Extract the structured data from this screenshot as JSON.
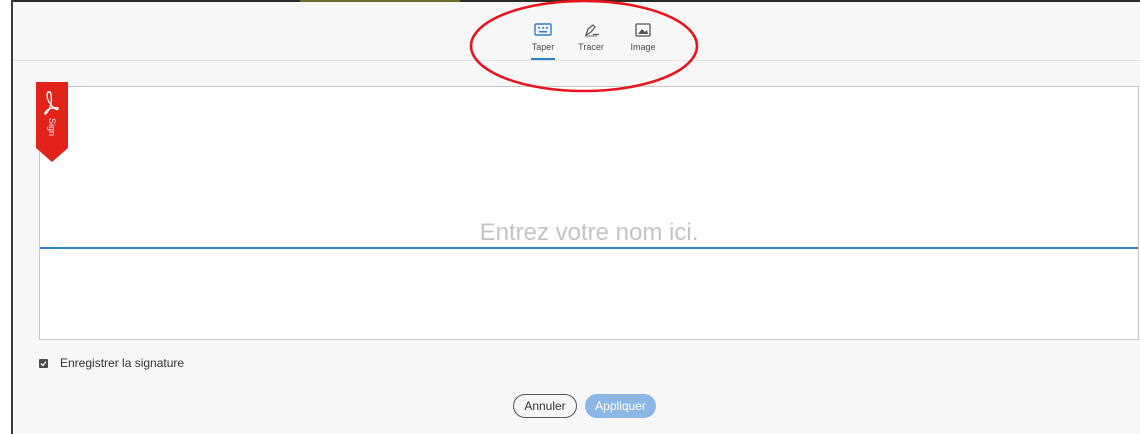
{
  "tabs": [
    {
      "label": "Taper",
      "icon": "keyboard-icon",
      "active": true
    },
    {
      "label": "Tracer",
      "icon": "pen-draw-icon",
      "active": false
    },
    {
      "label": "Image",
      "icon": "image-icon",
      "active": false
    }
  ],
  "signature_area": {
    "placeholder": "Entrez votre nom ici.",
    "tag_text": "Sign",
    "tag_color": "#e2231a",
    "baseline_color": "#2d7dd2"
  },
  "save_signature": {
    "label": "Enregistrer la signature",
    "checked": true
  },
  "buttons": {
    "cancel": "Annuler",
    "apply": "Appliquer"
  },
  "annotation": {
    "shape": "ellipse",
    "color": "#e8131b"
  }
}
